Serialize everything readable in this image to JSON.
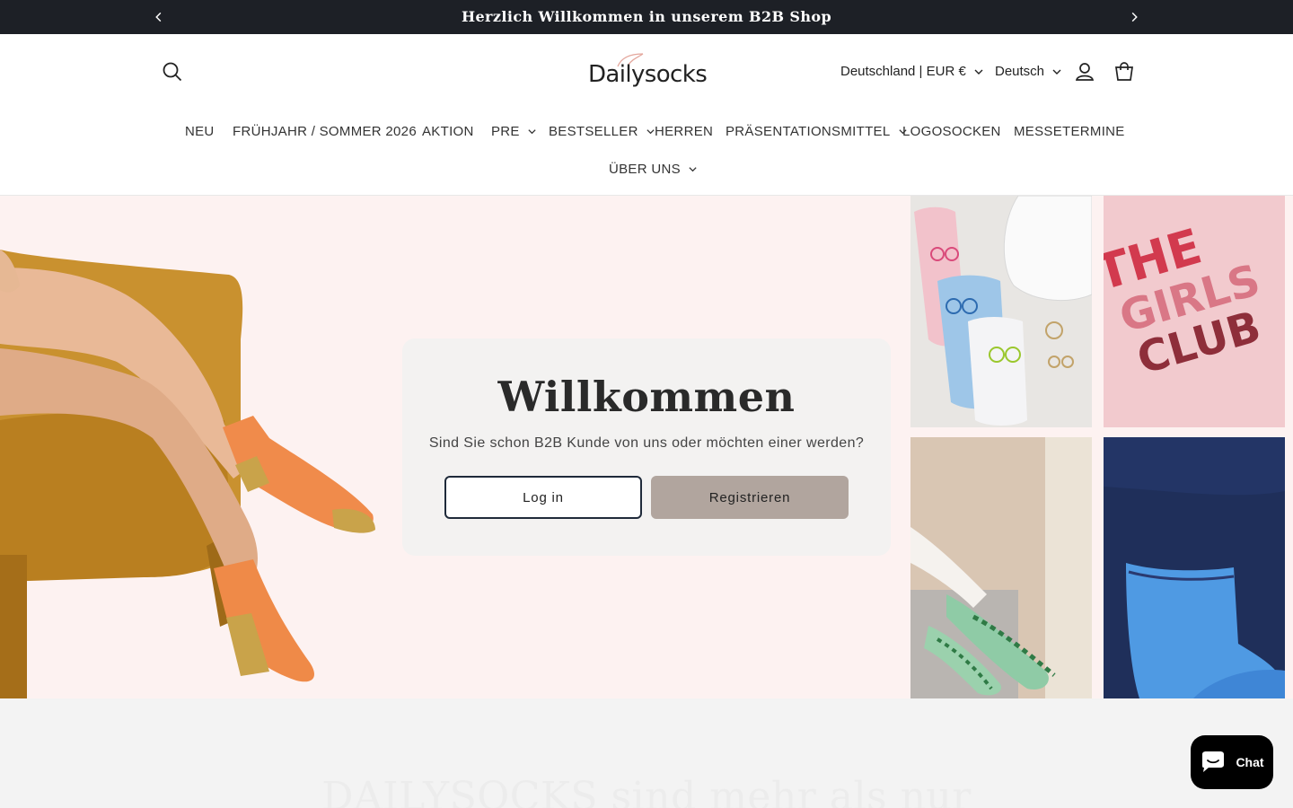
{
  "announcement": {
    "text": "Herzlich Willkommen in unserem B2B Shop",
    "prev_icon": "chevron-left-icon",
    "next_icon": "chevron-right-icon"
  },
  "header": {
    "logo_text": "Dailysocks",
    "country_selector": "Deutschland | EUR €",
    "language_selector": "Deutsch",
    "icons": [
      "search-icon",
      "account-icon",
      "cart-icon"
    ]
  },
  "nav": {
    "items": [
      {
        "label": "NEU",
        "has_dropdown": false
      },
      {
        "label": "FRÜHJAHR / SOMMER 2026",
        "has_dropdown": false
      },
      {
        "label": "AKTION",
        "has_dropdown": false
      },
      {
        "label": "PRE",
        "has_dropdown": true
      },
      {
        "label": "BESTSELLER",
        "has_dropdown": true
      },
      {
        "label": "HERREN",
        "has_dropdown": false
      },
      {
        "label": "PRÄSENTATIONSMITTEL",
        "has_dropdown": true
      },
      {
        "label": "LOGOSOCKEN",
        "has_dropdown": false
      },
      {
        "label": "MESSETERMINE",
        "has_dropdown": false
      },
      {
        "label": "ÜBER UNS",
        "has_dropdown": true
      }
    ]
  },
  "hero": {
    "title": "Willkommen",
    "subtitle": "Sind Sie schon B2B Kunde von uns oder möchten einer werden?",
    "login_label": "Log in",
    "register_label": "Registrieren",
    "tile_2_text": "THE GIRLS CLUB"
  },
  "below": {
    "heading": "DAILYSOCKS sind mehr als nur"
  },
  "chat": {
    "label": "Chat"
  },
  "colors": {
    "announcement_bg": "#1d2026",
    "hero_bg": "#fdf2f1",
    "register_btn": "#b1a59e",
    "login_border": "#1f2a3a"
  }
}
